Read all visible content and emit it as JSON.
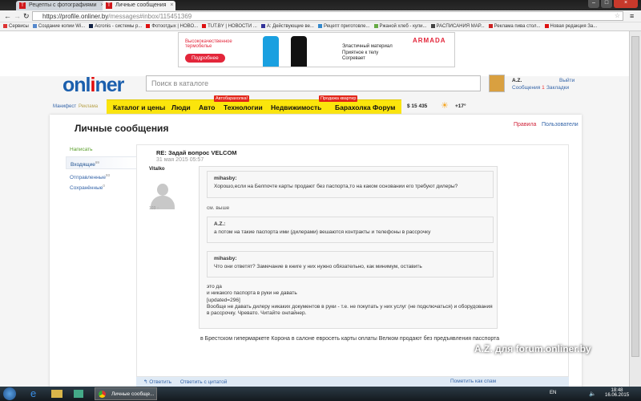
{
  "browser": {
    "tabs": [
      {
        "title": "Рецепты с фотографиями"
      },
      {
        "title": "Личные сообщения"
      }
    ],
    "url_host": "https://profile.onliner.by",
    "url_path": "/messages#inbox/115451369",
    "bookmarks": [
      "Сервисы",
      "Создание копии Wi...",
      "Acronis - системы р...",
      "Фотоотдых | НОВО...",
      "TUT.BY | НОВОСТИ ...",
      "А: Действующие ве...",
      "Рецепт приготовле...",
      "Ржаной хлеб - кули...",
      "РАСПИСАНИЯ МАР...",
      "Реклама пива стол...",
      "Новая редакция За..."
    ]
  },
  "ad": {
    "headline": "Высококачественное термобелье",
    "button": "Подробнее",
    "brand": "ARMADA",
    "features": "Эластичный материал\nПриятное к телу\nСогревает"
  },
  "header": {
    "logo_a": "onl",
    "logo_b": "i",
    "logo_c": "ner",
    "search_placeholder": "Поиск в каталоге",
    "user": "A.Z.",
    "messages": "Сообщения",
    "messages_count": "1",
    "logout": "Выйти",
    "bookmarks": "Закладки",
    "manifest": "Манифест",
    "ads": "Реклама"
  },
  "nav": {
    "items": [
      "Каталог и цены",
      "Люди",
      "Авто",
      "Технологии",
      "Недвижимость",
      "Барахолка",
      "Форум"
    ],
    "badge_auto": "Автобарахолка!",
    "badge_flat": "Продажа квартир",
    "currency": "$ 15 435",
    "temp": "+17°"
  },
  "page": {
    "title": "Личные сообщения",
    "rules": "Правила",
    "users": "Пользователи"
  },
  "sidebar": {
    "compose": "Написать",
    "inbox": "Входящие",
    "inbox_count": "69",
    "sent": "Отправленные",
    "sent_count": "93",
    "saved": "Сохранённые",
    "saved_count": "0"
  },
  "message": {
    "subject": "RE: Задай вопрос VELCOM",
    "date": "31 мая 2015  05:57",
    "author": "Vitalko",
    "author_posts": "103",
    "q1_author": "mihasby:",
    "q1_text": "Хорошо,если на Белпочте карты продают без паспорта,то на каком основании его требуют дилеры?",
    "reply1": "см. выше",
    "q2_author": "A.Z.:",
    "q2_text": "а потом на такие паспорта ими (дилерами) вешаются контракты и телефоны в рассрочку",
    "q3_author": "mihasby:",
    "q3_text": "Что они ответят? Замечание в книге у них нужно обязательно, как минимум, оставить",
    "line1": "это да",
    "line2": "и никакого паспорта в руки не давать",
    "line3": "[updated=296]",
    "line4": "Вообще не давать дилеру никаких документов в руки - т.е. не покупать у них услуг (не подключаться) и оборудования в рассрочку. Чревато. Читайте онлайнер.",
    "outer": "в Брестском гипермаркете Корона в салоне евросеть карты оплаты Велком продают без предъявления пасспорта"
  },
  "footer": {
    "reply": "Ответить",
    "reply_quote": "Ответить с цитатой",
    "spam": "Пометить как спам"
  },
  "watermark": "A.Z. для forum.onliner.by",
  "taskbar": {
    "window": "Личные сообще...",
    "lang": "EN",
    "time": "18:48",
    "date": "16.06.2015"
  }
}
